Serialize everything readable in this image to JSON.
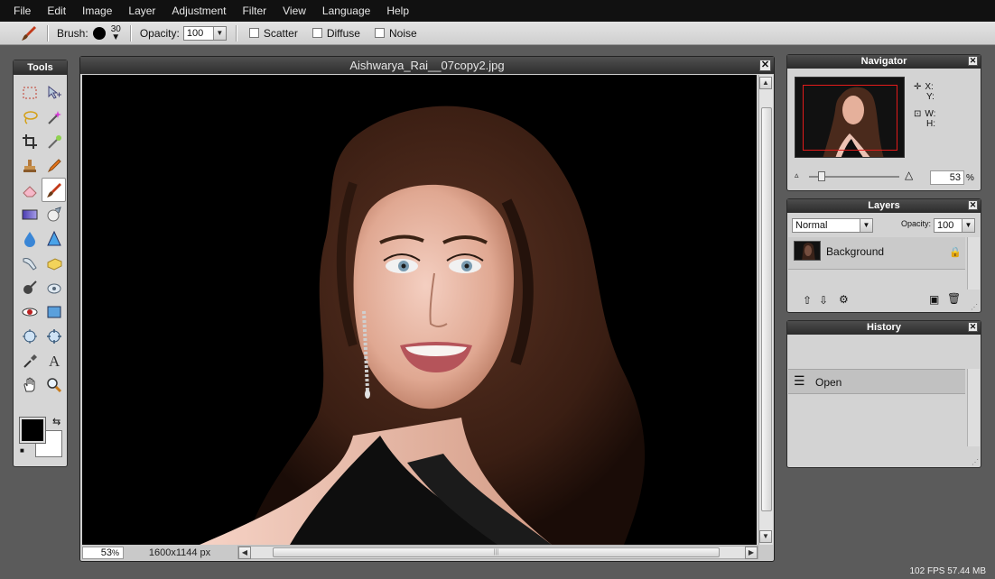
{
  "menubar": [
    "File",
    "Edit",
    "Image",
    "Layer",
    "Adjustment",
    "Filter",
    "View",
    "Language",
    "Help"
  ],
  "options": {
    "brush_label": "Brush:",
    "brush_size": "30",
    "opacity_label": "Opacity:",
    "opacity_value": "100",
    "scatter_label": "Scatter",
    "diffuse_label": "Diffuse",
    "noise_label": "Noise"
  },
  "tools": {
    "title": "Tools",
    "icons": [
      "marquee-icon",
      "move-icon",
      "lasso-icon",
      "wand-icon",
      "crop-icon",
      "magic-wand-icon",
      "clone-stamp-icon",
      "pencil-icon",
      "eraser-icon",
      "brush-icon",
      "gradient-icon",
      "replace-color-icon",
      "blur-icon",
      "sharpen-icon",
      "smudge-icon",
      "sponge-icon",
      "burn-icon",
      "dodge-icon",
      "red-eye-icon",
      "shape-icon",
      "bloat-icon",
      "pinch-icon",
      "color-picker-icon",
      "text-icon",
      "hand-icon",
      "zoom-icon"
    ],
    "foreground_color": "#000000",
    "background_color": "#ffffff"
  },
  "document": {
    "title": "Aishwarya_Rai__07copy2.jpg",
    "zoom_value": "53",
    "zoom_unit": "%",
    "dimensions": "1600x1144 px"
  },
  "navigator": {
    "title": "Navigator",
    "x_label": "X:",
    "y_label": "Y:",
    "w_label": "W:",
    "h_label": "H:",
    "zoom_value": "53",
    "zoom_unit": "%"
  },
  "layers": {
    "title": "Layers",
    "blend_mode": "Normal",
    "opacity_label": "Opacity:",
    "opacity_value": "100",
    "items": [
      {
        "name": "Background"
      }
    ]
  },
  "history": {
    "title": "History",
    "items": [
      {
        "label": "Open"
      }
    ]
  },
  "status": {
    "fps": "102 FPS 57.44 MB"
  },
  "colors": {
    "menubar_bg": "#111111",
    "workspace_bg": "#5b5b5b",
    "panel_bg": "#d3d3d3",
    "navigator_frame": "#e21b1b"
  }
}
